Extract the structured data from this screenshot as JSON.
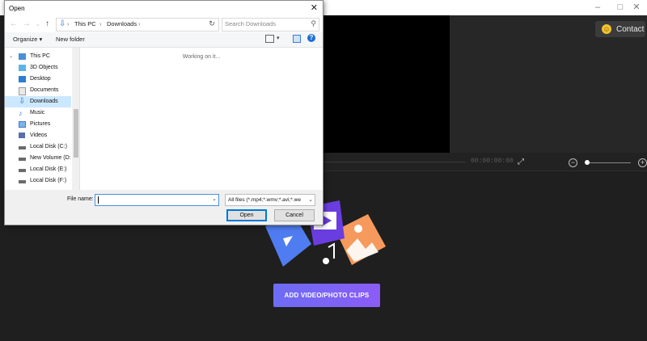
{
  "app": {
    "contact_label": "Contact",
    "timecode": "00:00:00:00",
    "add_button_label": "ADD VIDEO/PHOTO CLIPS"
  },
  "dialog": {
    "title": "Open",
    "breadcrumb": [
      "This PC",
      "Downloads"
    ],
    "search_placeholder": "Search Downloads",
    "toolbar": {
      "organize_label": "Organize",
      "new_folder_label": "New folder"
    },
    "sidebar": [
      {
        "label": "This PC",
        "icon": "pc-icon",
        "selected": false,
        "expander": true
      },
      {
        "label": "3D Objects",
        "icon": "3d-objects-icon",
        "selected": false
      },
      {
        "label": "Desktop",
        "icon": "desktop-icon",
        "selected": false
      },
      {
        "label": "Documents",
        "icon": "documents-icon",
        "selected": false
      },
      {
        "label": "Downloads",
        "icon": "downloads-icon",
        "selected": true
      },
      {
        "label": "Music",
        "icon": "music-icon",
        "selected": false
      },
      {
        "label": "Pictures",
        "icon": "pictures-icon",
        "selected": false
      },
      {
        "label": "Videos",
        "icon": "videos-icon",
        "selected": false
      },
      {
        "label": "Local Disk (C:)",
        "icon": "drive-icon",
        "selected": false
      },
      {
        "label": "New Volume (D:",
        "icon": "drive-icon",
        "selected": false
      },
      {
        "label": "Local Disk (E:)",
        "icon": "drive-icon",
        "selected": false
      },
      {
        "label": "Local Disk (F:)",
        "icon": "drive-icon",
        "selected": false
      }
    ],
    "status_text": "Working on it...",
    "file_name_label": "File name:",
    "file_name_value": "",
    "file_type_filter": "All files (*.mp4;*.wmv;*.avi;*.we",
    "open_label": "Open",
    "cancel_label": "Cancel"
  },
  "colors": {
    "accent_blue": "#0078d7",
    "add_button_start": "#6d6cf5",
    "add_button_end": "#8b5cf6",
    "selected_item": "#cce8ff"
  }
}
